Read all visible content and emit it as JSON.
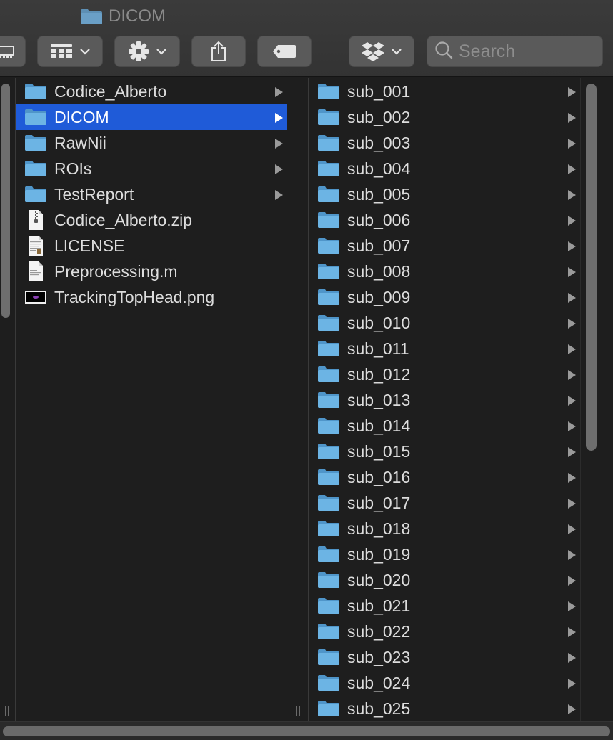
{
  "window": {
    "title": "DICOM"
  },
  "toolbar": {
    "search_placeholder": "Search"
  },
  "colors": {
    "selection": "#1f5bd8",
    "folder": "#6cb4e4",
    "background": "#1e1e1e"
  },
  "columns": [
    {
      "items": [
        {
          "name": "Codice_Alberto",
          "kind": "folder",
          "selected": false
        },
        {
          "name": "DICOM",
          "kind": "folder",
          "selected": true
        },
        {
          "name": "RawNii",
          "kind": "folder",
          "selected": false
        },
        {
          "name": "ROIs",
          "kind": "folder",
          "selected": false
        },
        {
          "name": "TestReport",
          "kind": "folder",
          "selected": false
        },
        {
          "name": "Codice_Alberto.zip",
          "kind": "zip",
          "selected": false
        },
        {
          "name": "LICENSE",
          "kind": "text",
          "selected": false
        },
        {
          "name": "Preprocessing.m",
          "kind": "doc",
          "selected": false
        },
        {
          "name": "TrackingTopHead.png",
          "kind": "image",
          "selected": false
        }
      ]
    },
    {
      "items": [
        {
          "name": "sub_001",
          "kind": "folder"
        },
        {
          "name": "sub_002",
          "kind": "folder"
        },
        {
          "name": "sub_003",
          "kind": "folder"
        },
        {
          "name": "sub_004",
          "kind": "folder"
        },
        {
          "name": "sub_005",
          "kind": "folder"
        },
        {
          "name": "sub_006",
          "kind": "folder"
        },
        {
          "name": "sub_007",
          "kind": "folder"
        },
        {
          "name": "sub_008",
          "kind": "folder"
        },
        {
          "name": "sub_009",
          "kind": "folder"
        },
        {
          "name": "sub_010",
          "kind": "folder"
        },
        {
          "name": "sub_011",
          "kind": "folder"
        },
        {
          "name": "sub_012",
          "kind": "folder"
        },
        {
          "name": "sub_013",
          "kind": "folder"
        },
        {
          "name": "sub_014",
          "kind": "folder"
        },
        {
          "name": "sub_015",
          "kind": "folder"
        },
        {
          "name": "sub_016",
          "kind": "folder"
        },
        {
          "name": "sub_017",
          "kind": "folder"
        },
        {
          "name": "sub_018",
          "kind": "folder"
        },
        {
          "name": "sub_019",
          "kind": "folder"
        },
        {
          "name": "sub_020",
          "kind": "folder"
        },
        {
          "name": "sub_021",
          "kind": "folder"
        },
        {
          "name": "sub_022",
          "kind": "folder"
        },
        {
          "name": "sub_023",
          "kind": "folder"
        },
        {
          "name": "sub_024",
          "kind": "folder"
        },
        {
          "name": "sub_025",
          "kind": "folder"
        }
      ]
    }
  ]
}
